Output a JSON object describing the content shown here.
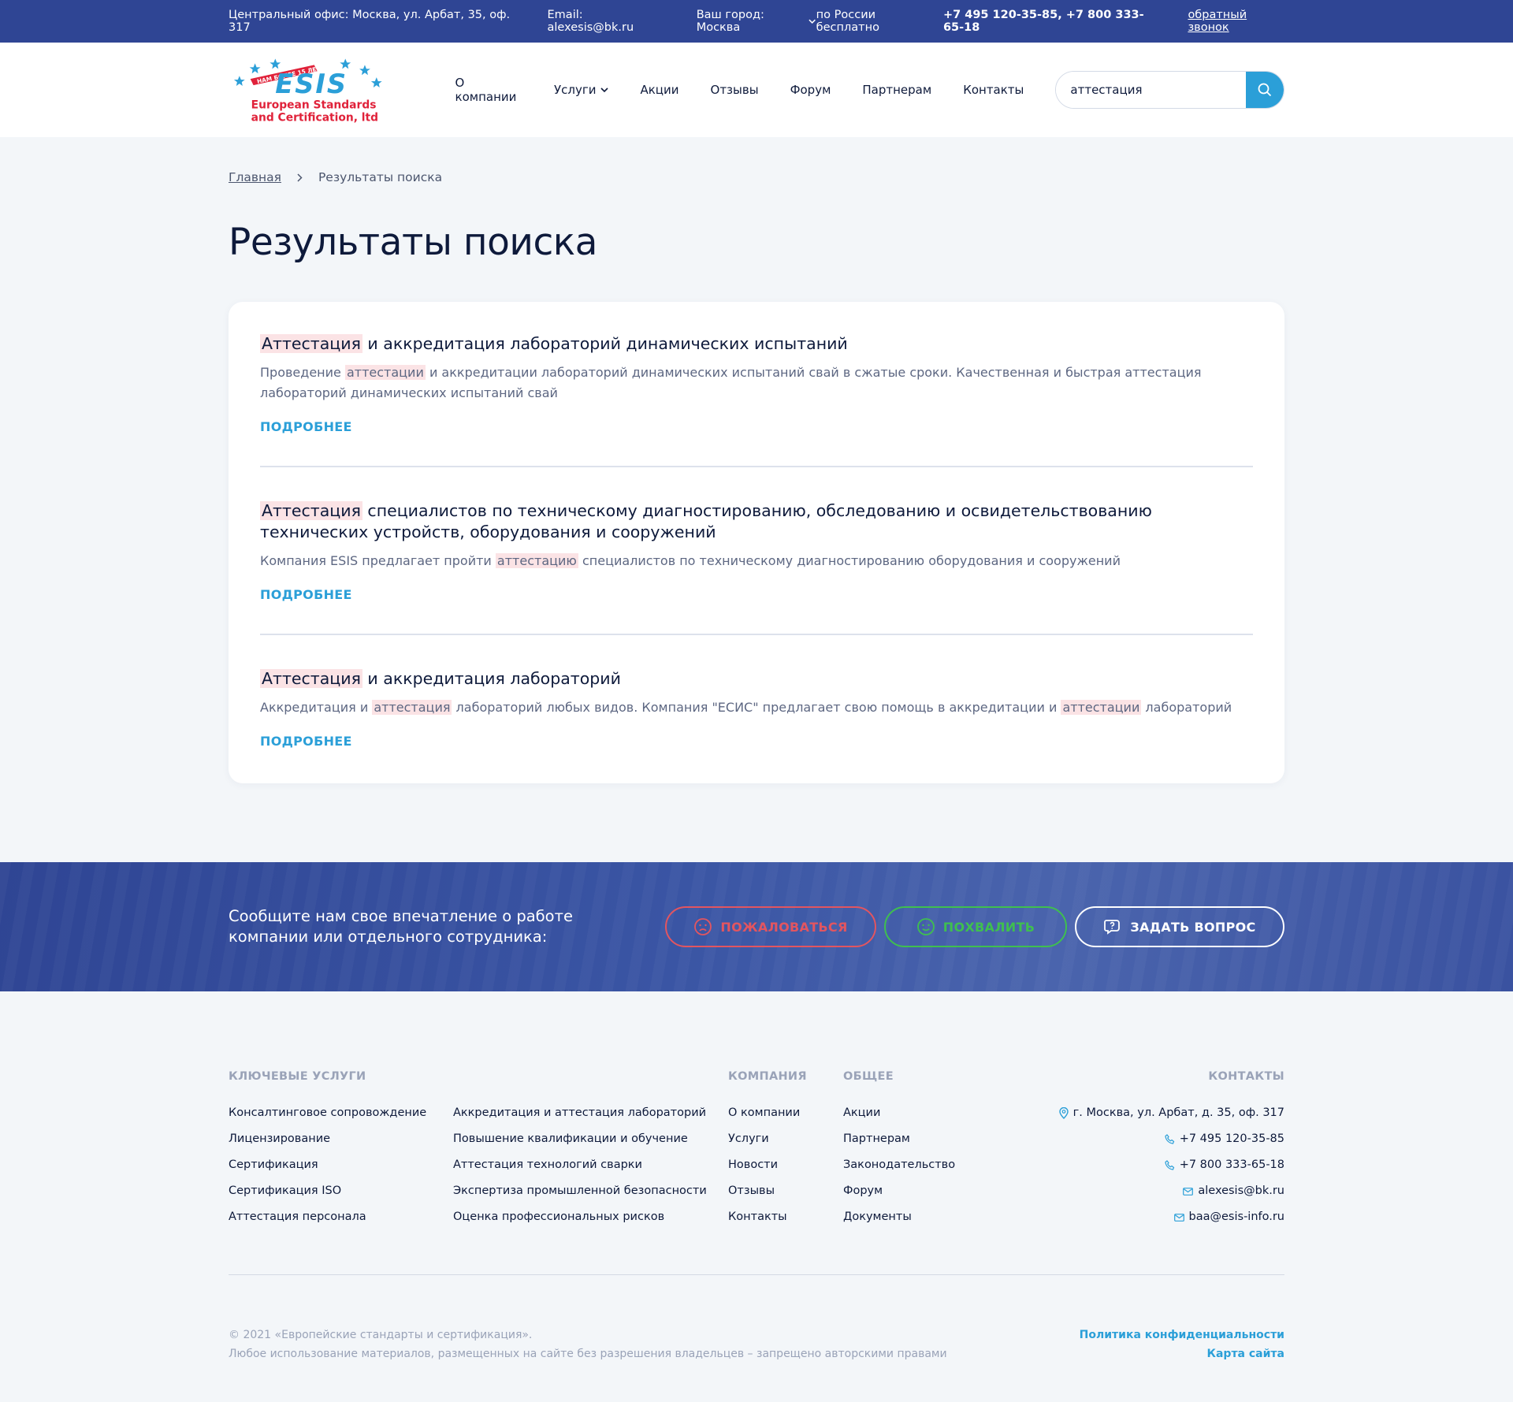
{
  "topbar": {
    "office": "Центральный офис: Москва, ул. Арбат, 35, оф. 317",
    "email": "Email: alexesis@bk.ru",
    "city": "Ваш город: Москва",
    "free_label": "по России бесплатно",
    "phones": "+7 495 120-35-85, +7 800 333-65-18",
    "callback": "обратный звонок"
  },
  "logo": {
    "badge": "НАМ БОЛЕЕ 15 ЛЕТ",
    "brand": "ESIS",
    "line1": "European Standards",
    "line2": "and Certification, ltd"
  },
  "nav": {
    "items": [
      "О компании",
      "Услуги",
      "Акции",
      "Отзывы",
      "Форум",
      "Партнерам",
      "Контакты"
    ]
  },
  "search": {
    "value": "аттестация"
  },
  "breadcrumb": {
    "home": "Главная",
    "current": "Результаты поиска"
  },
  "page_title": "Результаты поиска",
  "results": [
    {
      "title_hl": "Аттестация",
      "title_rest": " и аккредитация лабораторий динамических испытаний",
      "desc_parts": [
        "Проведение ",
        "аттестации",
        " и аккредитации лабораторий динамических испытаний свай в сжатые сроки. Качественная и быстрая аттестация лабораторий динамических испытаний свай"
      ],
      "more": "ПОДРОБНЕЕ"
    },
    {
      "title_hl": "Аттестация",
      "title_rest": " специалистов по техническому диагностированию, обследованию и освидетельствованию технических устройств, оборудования и сооружений",
      "desc_parts": [
        "Компания ESIS предлагает пройти ",
        "аттестацию",
        " специалистов по техническому диагностированию оборудования и сооружений"
      ],
      "more": "ПОДРОБНЕЕ"
    },
    {
      "title_hl": "Аттестация",
      "title_rest": " и аккредитация лабораторий",
      "desc_parts": [
        "Аккредитация и ",
        "аттестация",
        " лабораторий любых видов. Компания \"ЕСИС\" предлагает свою помощь в аккредитации и ",
        "аттестации",
        " лабораторий"
      ],
      "more": "ПОДРОБНЕЕ"
    }
  ],
  "feedback": {
    "text_line1": "Сообщите нам свое впечатление о работе",
    "text_line2": "компании или отдельного сотрудника:",
    "complain": "ПОЖАЛОВАТЬСЯ",
    "praise": "ПОХВАЛИТЬ",
    "ask": "ЗАДАТЬ ВОПРОС"
  },
  "footer": {
    "services_title": "КЛЮЧЕВЫЕ УСЛУГИ",
    "services_col1": [
      "Консалтинговое сопровождение",
      "Лицензирование",
      "Сертификация",
      "Сертификация ISO",
      "Аттестация персонала"
    ],
    "services_col2": [
      "Аккредитация и аттестация лабораторий",
      "Повышение квалификации и обучение",
      "Аттестация технологий сварки",
      "Экспертиза промышленной безопасности",
      "Оценка профессиональных рисков"
    ],
    "company_title": "КОМПАНИЯ",
    "company_items": [
      "О компании",
      "Услуги",
      "Новости",
      "Отзывы",
      "Контакты"
    ],
    "general_title": "ОБЩЕЕ",
    "general_items": [
      "Акции",
      "Партнерам",
      "Законодательство",
      "Форум",
      "Документы"
    ],
    "contacts_title": "КОНТАКТЫ",
    "address": "г. Москва, ул. Арбат, д. 35, оф. 317",
    "phone1": "+7 495 120-35-85",
    "phone2": "+7 800 333-65-18",
    "email1": "alexesis@bk.ru",
    "email2": "baa@esis-info.ru",
    "copyright": "© 2021 «Европейские стандарты и сертификация».",
    "rights": "Любое использование материалов, размещенных на сайте без разрешения владельцев – запрещено авторскими правами",
    "privacy": "Политика конфиденциальности",
    "sitemap": "Карта сайта"
  },
  "colors": {
    "primary_blue": "#2f4594",
    "accent": "#2b9fd8",
    "highlight": "#fbe3e5",
    "complain": "#e25560",
    "praise": "#3fbf4f"
  }
}
